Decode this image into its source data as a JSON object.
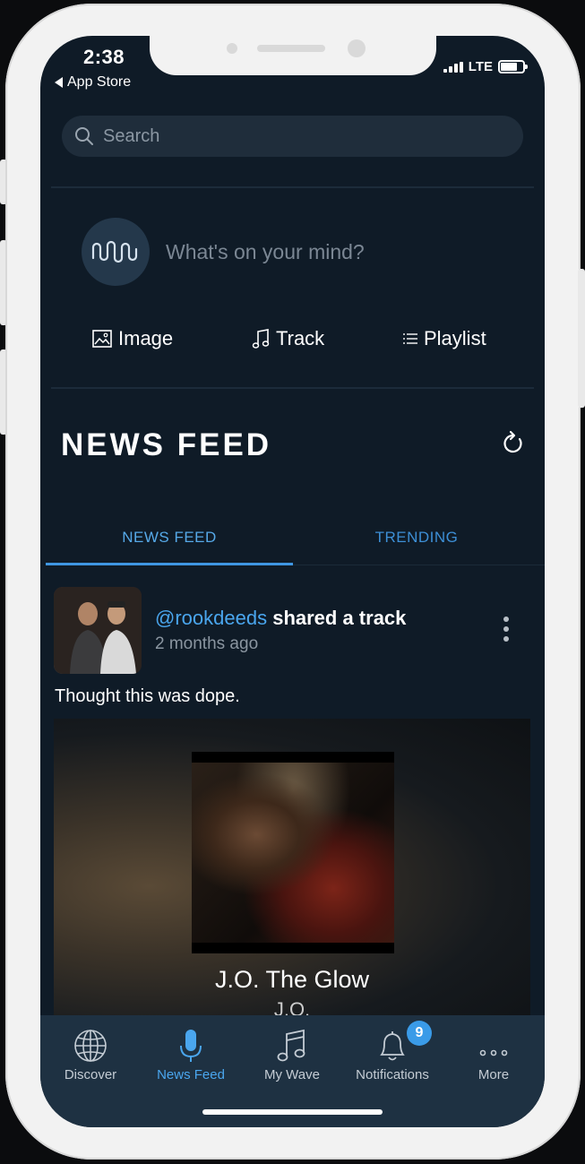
{
  "status_bar": {
    "time": "2:38",
    "back_label": "App Store",
    "network": "LTE"
  },
  "search": {
    "placeholder": "Search"
  },
  "composer": {
    "prompt": "What's on your mind?",
    "actions": [
      {
        "label": "Image",
        "icon": "image-icon"
      },
      {
        "label": "Track",
        "icon": "music-note-icon"
      },
      {
        "label": "Playlist",
        "icon": "list-icon"
      }
    ]
  },
  "feed": {
    "title": "NEWS FEED",
    "tabs": [
      {
        "label": "NEWS FEED",
        "active": true
      },
      {
        "label": "TRENDING",
        "active": false
      }
    ]
  },
  "post": {
    "username": "@rookdeeds",
    "action": "shared a track",
    "time_ago": "2 months ago",
    "text": "Thought this was dope.",
    "track": {
      "title": "J.O. The Glow",
      "artist": "J.O."
    }
  },
  "bottom_nav": {
    "items": [
      {
        "label": "Discover",
        "icon": "globe-icon",
        "active": false
      },
      {
        "label": "News Feed",
        "icon": "microphone-icon",
        "active": true
      },
      {
        "label": "My Wave",
        "icon": "music-note-icon",
        "active": false
      },
      {
        "label": "Notifications",
        "icon": "bell-icon",
        "active": false,
        "badge": "9"
      },
      {
        "label": "More",
        "icon": "more-dots-icon",
        "active": false
      }
    ]
  },
  "colors": {
    "background": "#0f1b27",
    "accent": "#4aa6ee",
    "nav_background": "#1e3142"
  }
}
